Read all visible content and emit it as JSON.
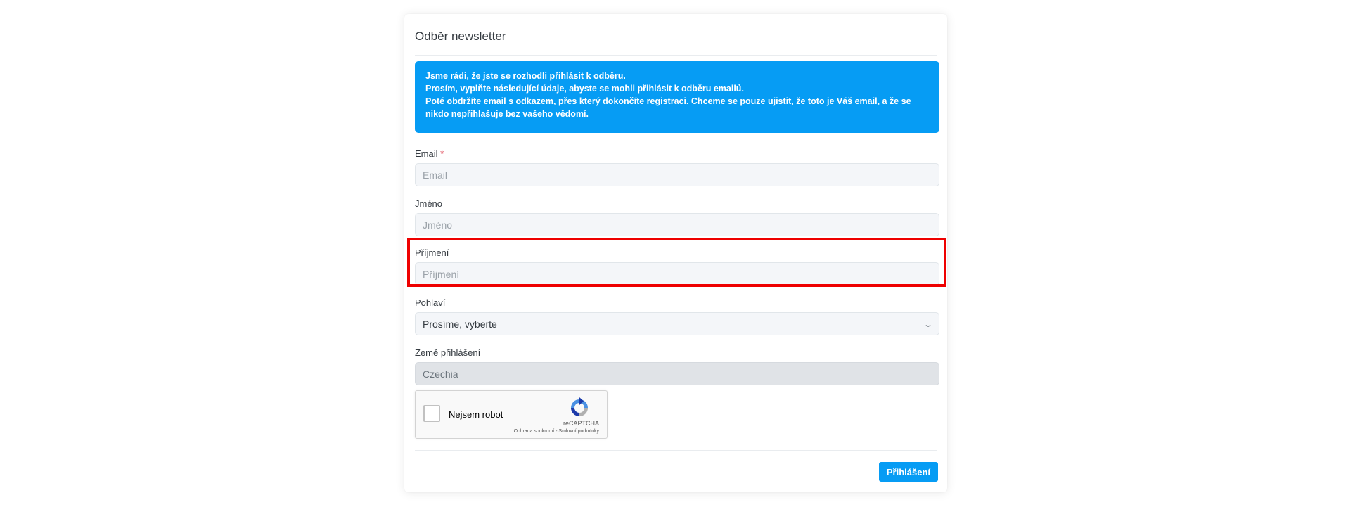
{
  "card": {
    "title": "Odběr newsletter"
  },
  "info": {
    "line1": "Jsme rádi, že jste se rozhodli přihlásit k odběru.",
    "line2": "Prosím, vyplňte následující údaje, abyste se mohli přihlásit k odběru emailů.",
    "line3": "Poté obdržíte email s odkazem, přes který dokončíte registraci. Chceme se pouze ujistit, že toto je Váš email, a že se nikdo nepřihlašuje bez vašeho vědomí."
  },
  "form": {
    "email": {
      "label": "Email",
      "required_mark": "*",
      "placeholder": "Email",
      "value": ""
    },
    "first_name": {
      "label": "Jméno",
      "placeholder": "Jméno",
      "value": ""
    },
    "last_name": {
      "label": "Příjmení",
      "placeholder": "Příjmení",
      "value": ""
    },
    "gender": {
      "label": "Pohlaví",
      "selected": "Prosíme, vyberte"
    },
    "country": {
      "label": "Země přihlášení",
      "value": "Czechia"
    }
  },
  "recaptcha": {
    "label": "Nejsem robot",
    "brand": "reCAPTCHA",
    "links": "Ochrana soukromí - Smluvní podmínky",
    "checked": false
  },
  "submit": {
    "label": "Přihlášení"
  },
  "colors": {
    "accent": "#069cf4",
    "highlight": "#ee0000",
    "required": "#dc3545"
  },
  "icons": {
    "select_arrow": "chevron-down-icon",
    "recaptcha_logo": "recaptcha-logo-icon"
  }
}
